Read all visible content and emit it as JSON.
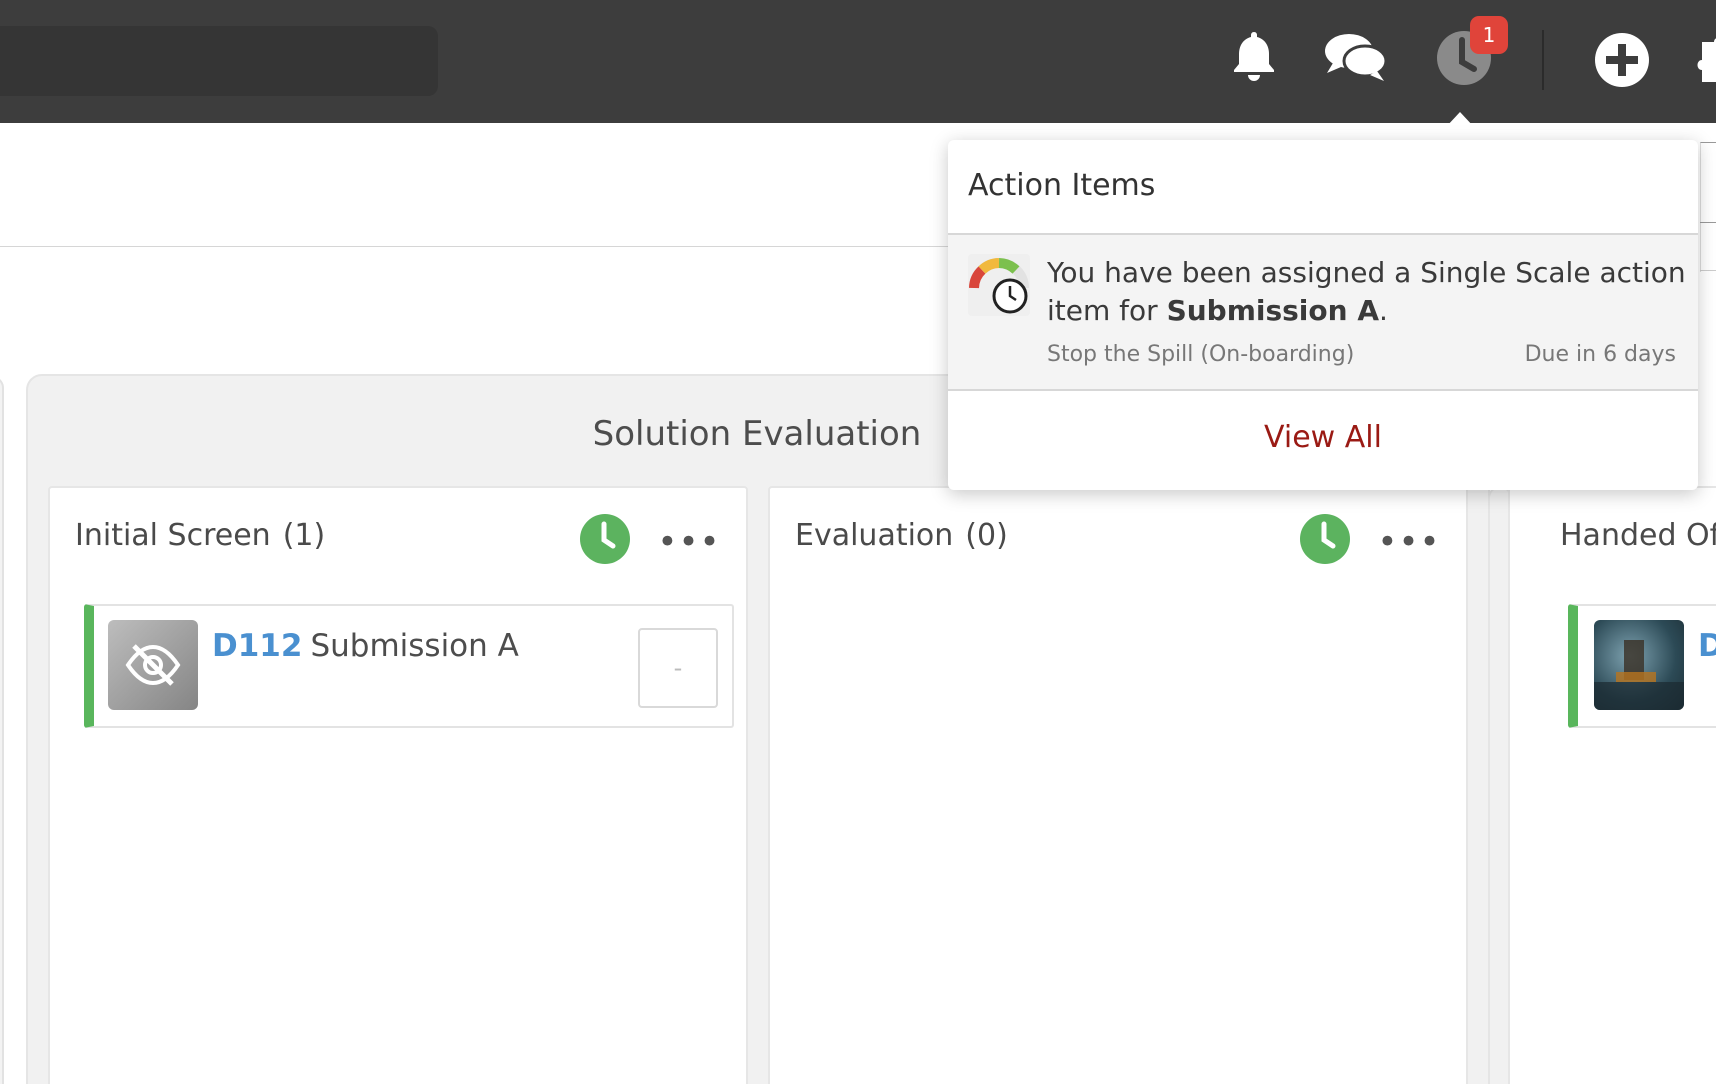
{
  "topbar": {
    "icons": [
      "bell-icon",
      "chat-icon",
      "clock-icon",
      "plus-circle-icon",
      "puzzle-icon"
    ],
    "action_badge": "1",
    "colors": {
      "bar": "#3d3d3d",
      "badge": "#e0443a"
    }
  },
  "board": {
    "group_title": "Solution Evaluation",
    "columns": [
      {
        "title": "Initial Screen",
        "count": "(1)",
        "cards": [
          {
            "id": "D112",
            "title": "Submission A",
            "score": "-"
          }
        ]
      },
      {
        "title": "Evaluation",
        "count": "(0)",
        "cards": []
      },
      {
        "title": "Handed Of",
        "cards": [
          {
            "id": "D"
          }
        ]
      }
    ],
    "colors": {
      "stage_accent": "#59b65c",
      "id_link": "#4a90d0"
    }
  },
  "dropdown": {
    "title": "Action Items",
    "item": {
      "message_prefix": "You have been assigned a Single Scale action item for ",
      "message_bold": "Submission A",
      "message_suffix": ".",
      "source": "Stop the Spill (On-boarding)",
      "due": "Due in 6 days"
    },
    "view_all": "View All",
    "colors": {
      "view_all": "#9a1a14"
    }
  }
}
